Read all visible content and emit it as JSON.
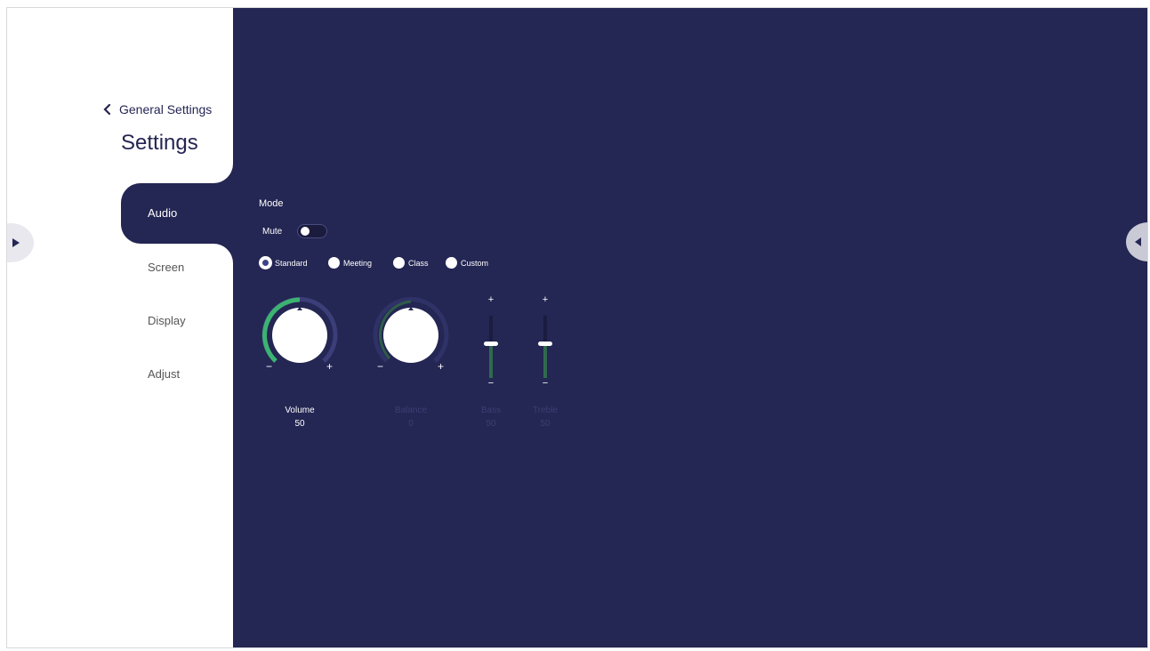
{
  "sidebar": {
    "back_label": "General Settings",
    "title": "Settings",
    "items": [
      {
        "label": "Audio",
        "active": true
      },
      {
        "label": "Screen",
        "active": false
      },
      {
        "label": "Display",
        "active": false
      },
      {
        "label": "Adjust",
        "active": false
      }
    ]
  },
  "audio": {
    "mode_label": "Mode",
    "mute_label": "Mute",
    "mute_on": false,
    "modes": [
      {
        "label": "Standard",
        "selected": true
      },
      {
        "label": "Meeting",
        "selected": false
      },
      {
        "label": "Class",
        "selected": false
      },
      {
        "label": "Custom",
        "selected": false
      }
    ],
    "volume": {
      "label": "Volume",
      "value": "50",
      "minus": "−",
      "plus": "+"
    },
    "balance": {
      "label": "Balance",
      "value": "0",
      "minus": "−",
      "plus": "+"
    },
    "bass": {
      "label": "Bass",
      "value": "50",
      "plus": "+",
      "minus": "−"
    },
    "treble": {
      "label": "Treble",
      "value": "50",
      "plus": "+",
      "minus": "−"
    }
  },
  "colors": {
    "panel": "#242653",
    "accent_green": "#3cb371",
    "dim_text": "#3c3f72"
  }
}
